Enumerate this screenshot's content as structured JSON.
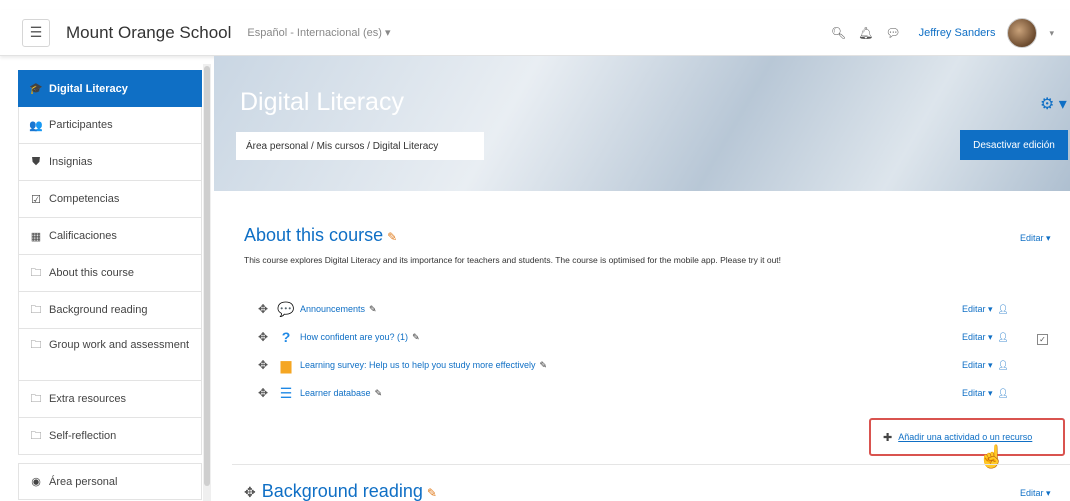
{
  "navbar": {
    "menu_icon": "hamburger-icon",
    "site_name": "Mount Orange School",
    "language": "Español - Internacional (es) ▾",
    "search_icon": "search-icon",
    "bell_icon": "bell-icon",
    "chat_icon": "chat-icon",
    "user_name": "Jeffrey Sanders",
    "user_caret": "▾"
  },
  "sidebar": {
    "items": [
      {
        "label": "Digital Literacy",
        "icon": "graduation-cap-icon",
        "glyph": "🎓"
      },
      {
        "label": "Participantes",
        "icon": "users-icon",
        "glyph": "👥"
      },
      {
        "label": "Insignias",
        "icon": "shield-icon",
        "glyph": "⛊"
      },
      {
        "label": "Competencias",
        "icon": "checkbox-icon",
        "glyph": "☑"
      },
      {
        "label": "Calificaciones",
        "icon": "table-icon",
        "glyph": "▦"
      },
      {
        "label": "About this course",
        "icon": "folder-icon",
        "glyph": "🗀"
      },
      {
        "label": "Background reading",
        "icon": "folder-icon",
        "glyph": "🗀"
      },
      {
        "label": "Group work and assessment",
        "icon": "folder-icon",
        "glyph": "🗀"
      },
      {
        "label": "Extra resources",
        "icon": "folder-icon",
        "glyph": "🗀"
      },
      {
        "label": "Self-reflection",
        "icon": "folder-icon",
        "glyph": "🗀"
      },
      {
        "label": "Área personal",
        "icon": "dashboard-icon",
        "glyph": "◉"
      }
    ]
  },
  "header": {
    "course_title": "Digital Literacy",
    "gear_icon": "gear-icon",
    "gear_glyph": "⚙ ▾",
    "breadcrumb": "Área personal / Mis cursos / Digital Literacy",
    "edit_mode_button": "Desactivar edición"
  },
  "section1": {
    "title": "About this course",
    "edit_label": "Editar ▾",
    "summary": "This course explores Digital Literacy and its importance for teachers and students. The course is optimised for the mobile app. Please try it out!",
    "activities": [
      {
        "name": "Announcements",
        "icon": "forum-icon",
        "glyph": "💬",
        "color": "#4caf50",
        "edit": "Editar ▾"
      },
      {
        "name": "How confident are you? (1)",
        "icon": "question-icon",
        "glyph": "?",
        "color": "#1e88e5",
        "edit": "Editar ▾"
      },
      {
        "name": "Learning survey: Help us to help you study more effectively",
        "icon": "bar-chart-icon",
        "glyph": "▆",
        "color": "#f5a623",
        "edit": "Editar ▾"
      },
      {
        "name": "Learner database",
        "icon": "database-icon",
        "glyph": "☰",
        "color": "#1e88e5",
        "edit": "Editar ▾"
      }
    ],
    "add_activity": "Añadir una actividad o un recurso"
  },
  "section2": {
    "title": "Background reading",
    "edit_label": "Editar ▾"
  },
  "colors": {
    "primary": "#0f6fc5",
    "accent_pencil": "#e07b1c",
    "highlight_border": "#d9534f"
  }
}
